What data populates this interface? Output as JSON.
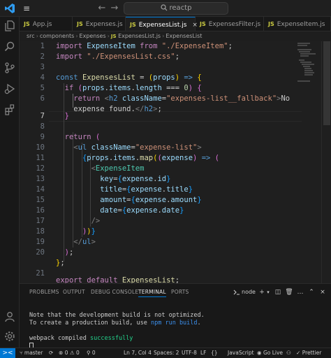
{
  "titlebar": {
    "search_text": "reactp",
    "back_glyph": "←",
    "forward_glyph": "→",
    "menu_glyph": "≡"
  },
  "tabs": [
    {
      "label": "App.js",
      "badge": "JS",
      "active": false
    },
    {
      "label": "Expenses.js",
      "badge": "JS",
      "active": false
    },
    {
      "label": "ExpensesList.js",
      "badge": "JS",
      "active": true,
      "close": "×"
    },
    {
      "label": "ExpensesFilter.js",
      "badge": "JS",
      "active": false
    },
    {
      "label": "ExpenseItem.js",
      "badge": "JS",
      "active": false
    }
  ],
  "breadcrumb": {
    "parts": [
      "src",
      "components",
      "Expenses",
      "ExpensesList.js"
    ],
    "badge": "JS",
    "last": "ExpensesList"
  },
  "editor": {
    "line_numbers": [
      "1",
      "2",
      "3",
      "4",
      "5",
      "6",
      "7",
      "8",
      "9",
      "10",
      "11",
      "12",
      "13",
      "14",
      "15",
      "16",
      "17",
      "18",
      "19",
      "20",
      "21"
    ],
    "current_line": "7"
  },
  "panel": {
    "tabs": [
      "PROBLEMS",
      "OUTPUT",
      "DEBUG CONSOLE",
      "TERMINAL",
      "PORTS"
    ],
    "active_tab": "TERMINAL",
    "terminal_name": "node",
    "terminal": {
      "line1": "Note that the development build is not optimized.",
      "line2_a": "To create a production build, use ",
      "line2_cmd": "npm run build",
      "line2_b": ".",
      "line3_a": "webpack compiled ",
      "line3_b": "successfully"
    }
  },
  "statusbar": {
    "branch": "master",
    "sync": "⟳",
    "errors": "0",
    "warnings": "0",
    "ports": "0",
    "position": "Ln 7, Col 4",
    "spaces": "Spaces: 2",
    "encoding": "UTF-8",
    "eol": "LF",
    "braces": "{}",
    "language": "JavaScript",
    "go_live": "Go Live",
    "prettier": "Prettier"
  },
  "colors": {
    "accent": "#0078d4",
    "editor_bg": "#1f1f1f",
    "keyword": "#c586c0",
    "string": "#ce9178",
    "js_badge": "#cbcb41"
  }
}
